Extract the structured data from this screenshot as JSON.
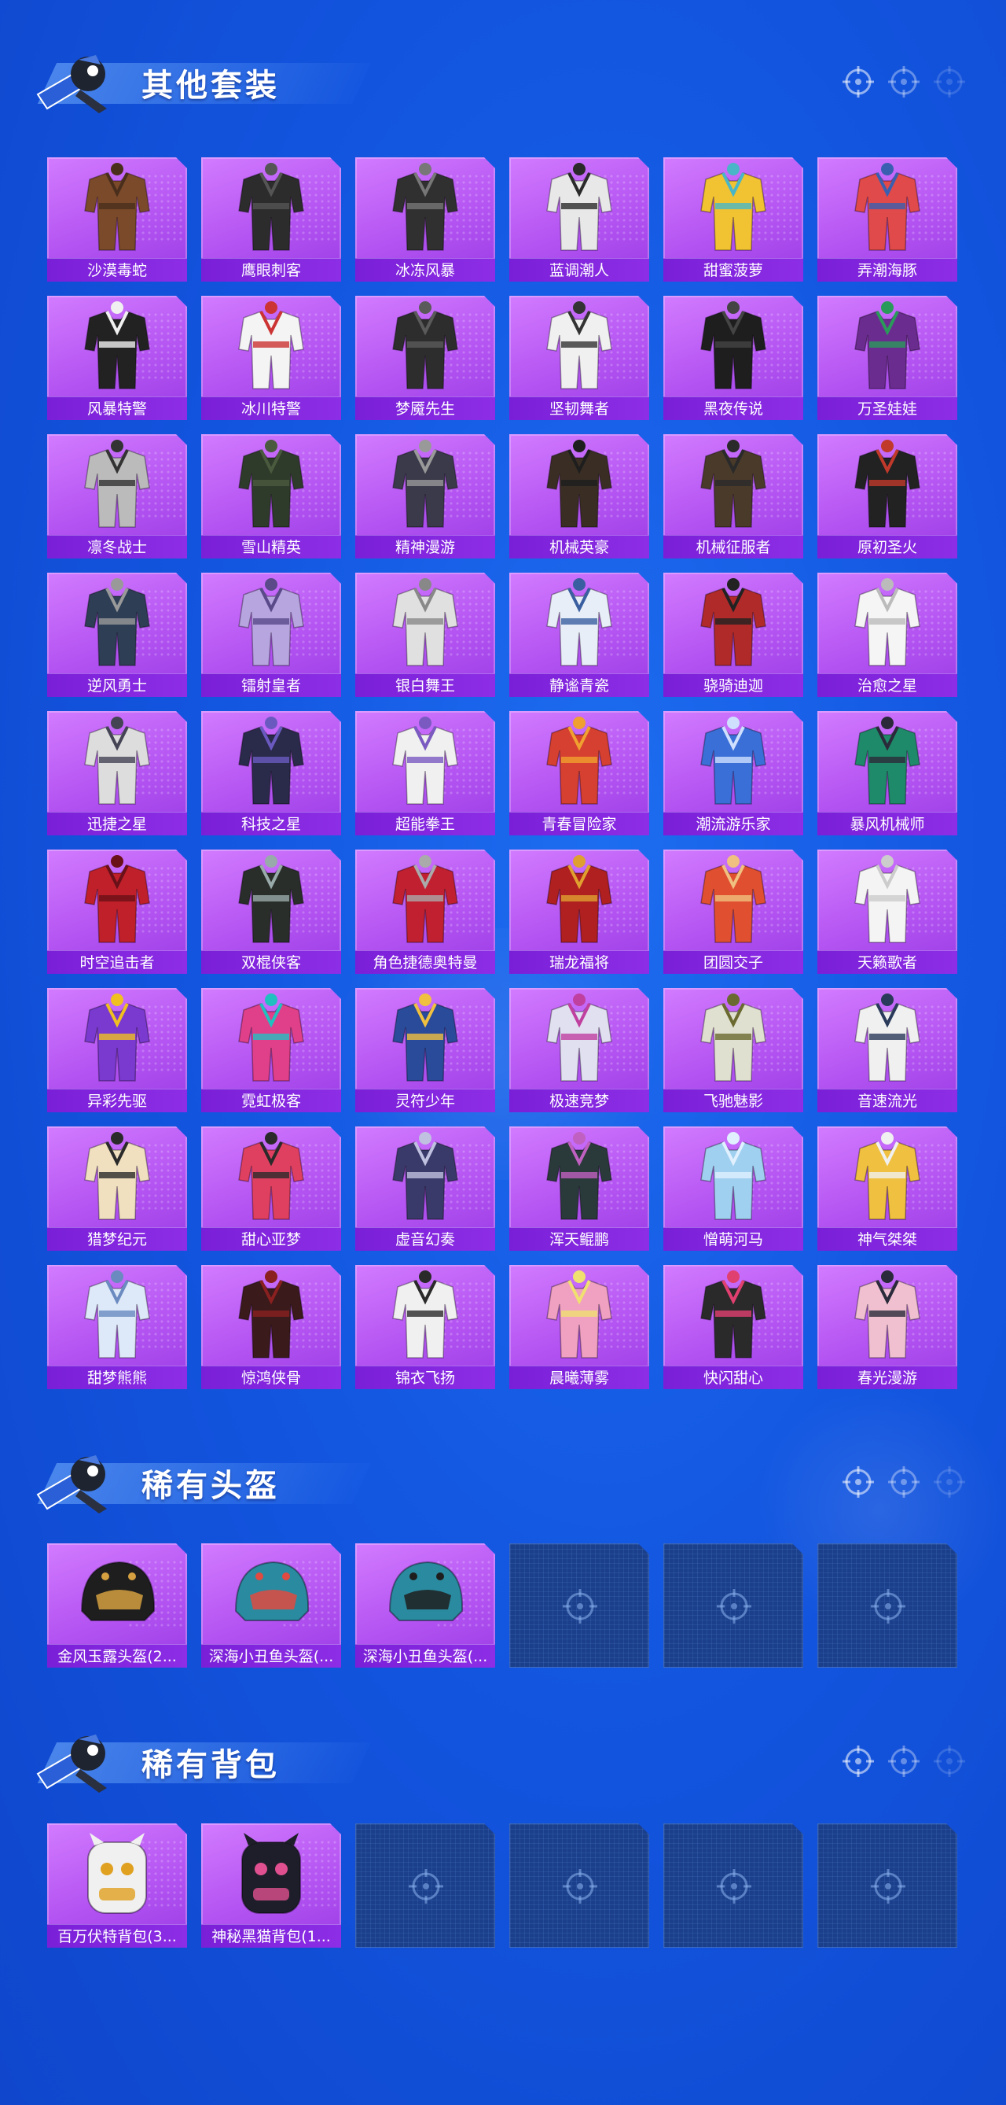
{
  "colors": {
    "accent_purple": "#b454f2",
    "label_purple": "#7a1fd8",
    "background_blue": "#1356e0",
    "empty_slot": "#1b3f8a"
  },
  "sections": {
    "outfits": {
      "title": "其他套装",
      "items": [
        {
          "name": "沙漠毒蛇",
          "palette": [
            "#7a4a2a",
            "#4a2e1c"
          ]
        },
        {
          "name": "鹰眼刺客",
          "palette": [
            "#2c2c2c",
            "#555"
          ]
        },
        {
          "name": "冰冻风暴",
          "palette": [
            "#303030",
            "#777"
          ]
        },
        {
          "name": "蓝调潮人",
          "palette": [
            "#e8e8e8",
            "#2a2a2a"
          ]
        },
        {
          "name": "甜蜜菠萝",
          "palette": [
            "#f1c232",
            "#49b6c7"
          ]
        },
        {
          "name": "弄潮海豚",
          "palette": [
            "#e04a4a",
            "#3a5fb0"
          ]
        },
        {
          "name": "风暴特警",
          "palette": [
            "#222",
            "#f0f0f0"
          ]
        },
        {
          "name": "冰川特警",
          "palette": [
            "#f4f4f4",
            "#c33"
          ]
        },
        {
          "name": "梦魇先生",
          "palette": [
            "#2d2d2d",
            "#5a5a5a"
          ]
        },
        {
          "name": "坚韧舞者",
          "palette": [
            "#f0f0f0",
            "#333"
          ]
        },
        {
          "name": "黑夜传说",
          "palette": [
            "#1e1e1e",
            "#444"
          ]
        },
        {
          "name": "万圣娃娃",
          "palette": [
            "#6b2c8f",
            "#2a9a5a"
          ]
        },
        {
          "name": "凛冬战士",
          "palette": [
            "#bbb",
            "#333"
          ]
        },
        {
          "name": "雪山精英",
          "palette": [
            "#2f3b2a",
            "#4a5a3e"
          ]
        },
        {
          "name": "精神漫游",
          "palette": [
            "#3a3a4a",
            "#999"
          ]
        },
        {
          "name": "机械英豪",
          "palette": [
            "#3a2e24",
            "#1e1e1e"
          ]
        },
        {
          "name": "机械征服者",
          "palette": [
            "#4a3a2a",
            "#2a2a2a"
          ]
        },
        {
          "name": "原初圣火",
          "palette": [
            "#222",
            "#c0392b"
          ]
        },
        {
          "name": "逆风勇士",
          "palette": [
            "#2d3e55",
            "#999"
          ]
        },
        {
          "name": "镭射皇者",
          "palette": [
            "#b7a5e0",
            "#5a4a8a"
          ]
        },
        {
          "name": "银白舞王",
          "palette": [
            "#e0e0e0",
            "#888"
          ]
        },
        {
          "name": "静谧青瓷",
          "palette": [
            "#e8eef8",
            "#3a5fa0"
          ]
        },
        {
          "name": "骁骑迪迦",
          "palette": [
            "#b02a2a",
            "#222"
          ]
        },
        {
          "name": "治愈之星",
          "palette": [
            "#f5f5f5",
            "#bbb"
          ]
        },
        {
          "name": "迅捷之星",
          "palette": [
            "#ddd",
            "#445"
          ]
        },
        {
          "name": "科技之星",
          "palette": [
            "#2a2a4a",
            "#6a5ac0"
          ]
        },
        {
          "name": "超能拳王",
          "palette": [
            "#f0f0f0",
            "#7a5ac0"
          ]
        },
        {
          "name": "青春冒险家",
          "palette": [
            "#d64030",
            "#f0a030"
          ]
        },
        {
          "name": "潮流游乐家",
          "palette": [
            "#3a6fd8",
            "#cfe0ff"
          ]
        },
        {
          "name": "暴风机械师",
          "palette": [
            "#1e8a6a",
            "#2a2a3a"
          ]
        },
        {
          "name": "时空追击者",
          "palette": [
            "#c0202a",
            "#6a1018"
          ]
        },
        {
          "name": "双棍侠客",
          "palette": [
            "#2a2e2a",
            "#9aa"
          ]
        },
        {
          "name": "角色捷德奥特曼",
          "palette": [
            "#c02030",
            "#aaa"
          ]
        },
        {
          "name": "瑞龙福将",
          "palette": [
            "#b02020",
            "#e0a030"
          ]
        },
        {
          "name": "团圆交子",
          "palette": [
            "#e05030",
            "#f0c080"
          ]
        },
        {
          "name": "天籁歌者",
          "palette": [
            "#f4f4f4",
            "#ccc"
          ]
        },
        {
          "name": "异彩先驱",
          "palette": [
            "#7a3ad0",
            "#f0c020"
          ]
        },
        {
          "name": "霓虹极客",
          "palette": [
            "#e0408a",
            "#20c0c0"
          ]
        },
        {
          "name": "灵符少年",
          "palette": [
            "#2a4a9a",
            "#f0c040"
          ]
        },
        {
          "name": "极速竞梦",
          "palette": [
            "#e0e0f0",
            "#c040a0"
          ]
        },
        {
          "name": "飞驰魅影",
          "palette": [
            "#e0e0d0",
            "#6a6a30"
          ]
        },
        {
          "name": "音速流光",
          "palette": [
            "#f0f0f0",
            "#2a3a5a"
          ]
        },
        {
          "name": "猎梦纪元",
          "palette": [
            "#f0e0c0",
            "#2a2a2a"
          ]
        },
        {
          "name": "甜心亚梦",
          "palette": [
            "#e04060",
            "#2a2a2a"
          ]
        },
        {
          "name": "虚音幻奏",
          "palette": [
            "#3a3a6a",
            "#c0c0e0"
          ]
        },
        {
          "name": "浑天鲲鹏",
          "palette": [
            "#2a3a3a",
            "#c060c0"
          ]
        },
        {
          "name": "憎萌河马",
          "palette": [
            "#a0d0f0",
            "#e0f0ff"
          ]
        },
        {
          "name": "神气桀桀",
          "palette": [
            "#f0c040",
            "#f0f0f0"
          ]
        },
        {
          "name": "甜梦熊熊",
          "palette": [
            "#dde8f8",
            "#6a8ac0"
          ]
        },
        {
          "name": "惊鸿侠骨",
          "palette": [
            "#3a1a1a",
            "#8a2020"
          ]
        },
        {
          "name": "锦衣飞扬",
          "palette": [
            "#f0f0f0",
            "#2a2a2a"
          ]
        },
        {
          "name": "晨曦薄雾",
          "palette": [
            "#f0a0c0",
            "#f0e070"
          ]
        },
        {
          "name": "快闪甜心",
          "palette": [
            "#2a2a2a",
            "#e04070"
          ]
        },
        {
          "name": "春光漫游",
          "palette": [
            "#f0c0d0",
            "#2a2a3a"
          ]
        }
      ]
    },
    "helmets": {
      "title": "稀有头盔",
      "items": [
        {
          "name": "金风玉露头盔(2...",
          "palette": [
            "#1e1e1e",
            "#d4a040"
          ]
        },
        {
          "name": "深海小丑鱼头盔(...",
          "palette": [
            "#2a8aa0",
            "#e04a40"
          ]
        },
        {
          "name": "深海小丑鱼头盔(...",
          "palette": [
            "#2a8aa0",
            "#1e1e1e"
          ]
        }
      ],
      "empty_slots": 3
    },
    "backpacks": {
      "title": "稀有背包",
      "items": [
        {
          "name": "百万伏特背包(3...",
          "palette": [
            "#f0f0f0",
            "#e0a020"
          ]
        },
        {
          "name": "神秘黑猫背包(1...",
          "palette": [
            "#1e1e2a",
            "#e05090"
          ]
        }
      ],
      "empty_slots": 4
    }
  }
}
